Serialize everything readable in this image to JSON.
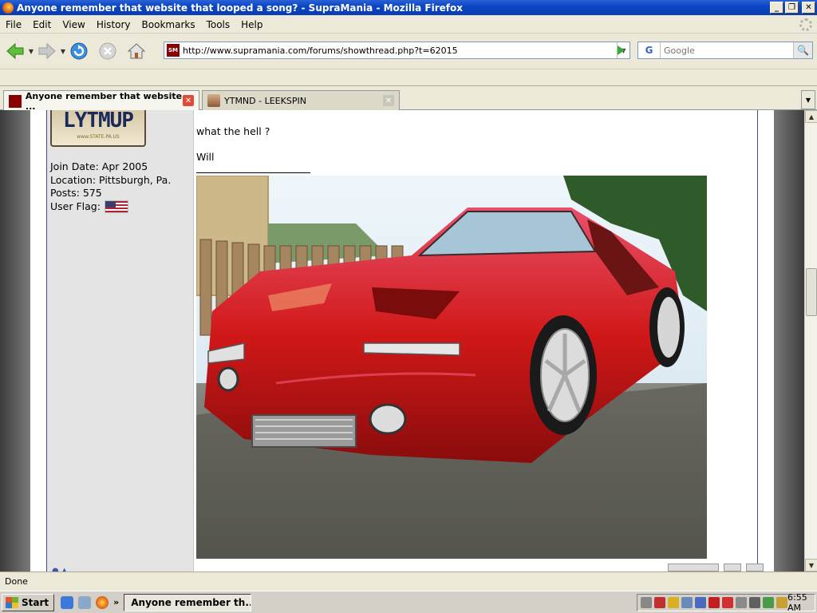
{
  "window": {
    "title": "Anyone remember that website that looped a song? - SupraMania - Mozilla Firefox",
    "min_glyph": "_",
    "max_glyph": "❐",
    "close_glyph": "✕"
  },
  "menu": {
    "file": "File",
    "edit": "Edit",
    "view": "View",
    "history": "History",
    "bookmarks": "Bookmarks",
    "tools": "Tools",
    "help": "Help"
  },
  "nav": {
    "back_icon": "back-arrow-icon",
    "forward_icon": "forward-arrow-icon",
    "reload_icon": "reload-icon",
    "stop_icon": "stop-icon",
    "home_icon": "home-icon",
    "url": "http://www.supramania.com/forums/showthread.php?t=62015",
    "favicon_text": "SM",
    "search_engine": "G",
    "search_placeholder": "Google"
  },
  "tabs": [
    {
      "label": "Anyone remember that website ...",
      "active": true
    },
    {
      "label": "YTMND - LEEKSPIN",
      "active": false
    }
  ],
  "post": {
    "plate_text": "LYTMUP",
    "plate_sub": "www.STATE.PA.US",
    "join_date": "Join Date: Apr 2005",
    "location": "Location: Pittsburgh, Pa.",
    "posts": "Posts: 575",
    "user_flag_label": "User Flag:",
    "body_line1": "what the hell ?",
    "body_line2": "Will"
  },
  "status": {
    "text": "Done"
  },
  "taskbar": {
    "start_label": "Start",
    "chevron": "»",
    "task_label": "Anyone remember th...",
    "clock": "6:55 AM"
  },
  "colors": {
    "titlebar": "#0b46c2",
    "car_red": "#d01818",
    "page_bg": "#ffffff",
    "userpane_bg": "#e4e4e4"
  }
}
